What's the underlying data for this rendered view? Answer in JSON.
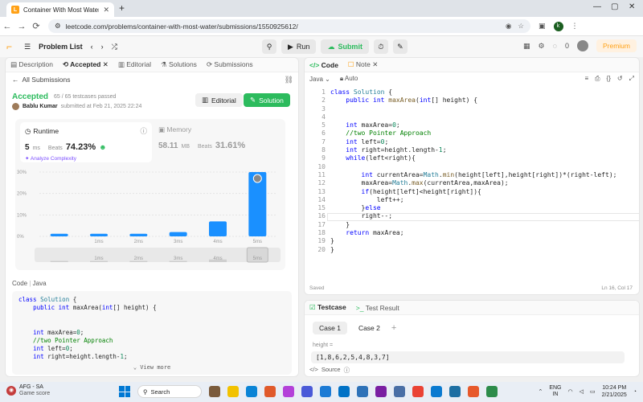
{
  "browser": {
    "tab_title": "Container With Most Water - Le",
    "url": "leetcode.com/problems/container-with-most-water/submissions/1550925612/",
    "profile_initial": "k"
  },
  "lc_header": {
    "problem_list": "Problem List",
    "run": "Run",
    "submit": "Submit",
    "coins": "0",
    "premium": "Premium"
  },
  "left_tabs": [
    "Description",
    "Accepted",
    "Editorial",
    "Solutions",
    "Submissions"
  ],
  "submission": {
    "back_label": "All Submissions",
    "status": "Accepted",
    "testcases": "65 / 65 testcases passed",
    "author": "Bablu Kumar",
    "submitted_at": "submitted at Feb 21, 2025 22:24",
    "editorial_btn": "Editorial",
    "solution_btn": "Solution"
  },
  "runtime": {
    "label": "Runtime",
    "value": "5",
    "unit": "ms",
    "beats_label": "Beats",
    "beats": "74.23%",
    "analyze": "Analyze Complexity"
  },
  "memory": {
    "label": "Memory",
    "value": "58.11",
    "unit": "MB",
    "beats_label": "Beats",
    "beats": "31.61%"
  },
  "chart_data": {
    "type": "bar",
    "categories": [
      "",
      "1ms",
      "2ms",
      "3ms",
      "4ms",
      "5ms"
    ],
    "values": [
      1.2,
      1.2,
      1.2,
      2.0,
      7.0,
      30.0
    ],
    "highlight_index": 5,
    "yticks": [
      "0%",
      "10%",
      "20%",
      "30%"
    ],
    "ylim": [
      0,
      30
    ],
    "mini_labels": [
      "1ms",
      "2ms",
      "3ms",
      "4ms",
      "5ms"
    ],
    "bar_color": "#1a90ff",
    "light_bar_color": "#1a90ff"
  },
  "code_section": {
    "label": "Code",
    "lang": "Java",
    "snippet": [
      "class Solution {",
      "    public int maxArea(int[] height) {",
      "",
      "",
      "    int maxArea=0;",
      "    //two Pointer Approach",
      "    int left=0;",
      "    int right=height.length-1;"
    ],
    "view_more": "View more"
  },
  "code_tabs": [
    "Code",
    "Note"
  ],
  "editor": {
    "lang": "Java",
    "mode": "Auto",
    "saved": "Saved",
    "cursor": "Ln 16, Col 17"
  },
  "test_tabs": [
    "Testcase",
    "Test Result"
  ],
  "testcase": {
    "cases": [
      "Case 1",
      "Case 2"
    ],
    "param_label": "height =",
    "param_value": "[1,8,6,2,5,4,8,3,7]",
    "source": "Source"
  },
  "taskbar": {
    "weather_title": "AFG - SA",
    "weather_sub": "Game score",
    "search": "Search",
    "lang1": "ENG",
    "lang2": "IN",
    "time": "10:24 PM",
    "date": "2/21/2025"
  }
}
